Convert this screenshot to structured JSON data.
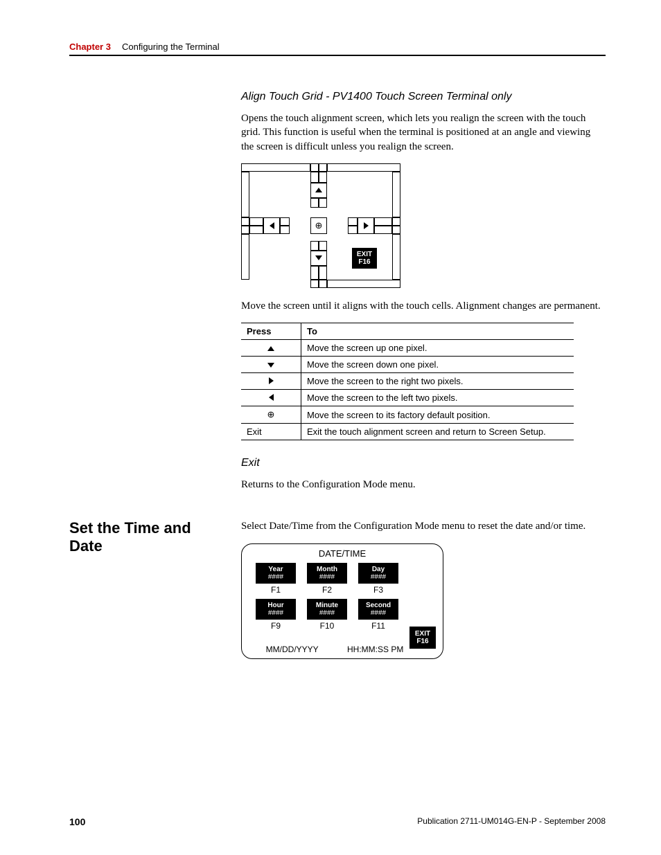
{
  "header": {
    "chapter_label": "Chapter 3",
    "chapter_title": "Configuring the Terminal"
  },
  "section1": {
    "heading": "Align Touch Grid - PV1400 Touch Screen Terminal only",
    "para1": "Opens the touch alignment screen, which lets you realign the screen with the touch grid. This function is useful when the terminal is positioned at an angle and viewing the screen is difficult unless you realign the screen.",
    "para2": "Move the screen until it aligns with the touch cells. Alignment changes are permanent."
  },
  "diagram": {
    "exit_line1": "EXIT",
    "exit_line2": "F16",
    "crosshair": "⊕"
  },
  "table": {
    "col1": "Press",
    "col2": "To",
    "rows": [
      {
        "key_type": "up",
        "to": "Move the screen up one pixel."
      },
      {
        "key_type": "down",
        "to": "Move the screen down one pixel."
      },
      {
        "key_type": "right",
        "to": "Move the screen to the right two pixels."
      },
      {
        "key_type": "left",
        "to": "Move the screen to the left two pixels."
      },
      {
        "key_type": "cross",
        "key_text": "⊕",
        "to": "Move the screen to its factory default position."
      },
      {
        "key_type": "text",
        "key_text": "Exit",
        "to": "Exit the touch alignment screen and return to Screen Setup."
      }
    ]
  },
  "exit_section": {
    "heading": "Exit",
    "para": "Returns to the Configuration Mode menu."
  },
  "section2": {
    "side_heading": "Set the Time and Date",
    "para": "Select Date/Time from the Configuration Mode menu to reset the date and/or time."
  },
  "dt_panel": {
    "title": "DATE/TIME",
    "row1": [
      {
        "label": "Year",
        "hash": "####",
        "fkey": "F1"
      },
      {
        "label": "Month",
        "hash": "####",
        "fkey": "F2"
      },
      {
        "label": "Day",
        "hash": "####",
        "fkey": "F3"
      }
    ],
    "row2": [
      {
        "label": "Hour",
        "hash": "####",
        "fkey": "F9"
      },
      {
        "label": "Minute",
        "hash": "####",
        "fkey": "F10"
      },
      {
        "label": "Second",
        "hash": "####",
        "fkey": "F11"
      }
    ],
    "exit_line1": "EXIT",
    "exit_line2": "F16",
    "bottom_left": "MM/DD/YYYY",
    "bottom_right": "HH:MM:SS PM"
  },
  "footer": {
    "page_number": "100",
    "pub": "Publication 2711-UM014G-EN-P - September 2008"
  }
}
